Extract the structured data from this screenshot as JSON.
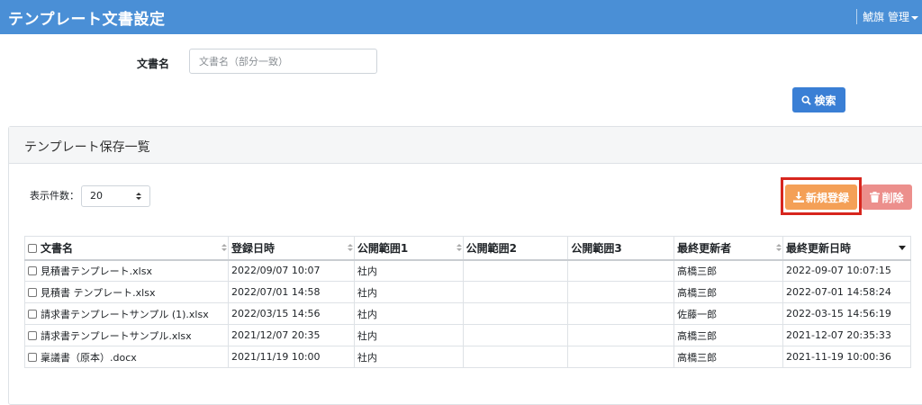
{
  "header": {
    "title": "テンプレート文書設定",
    "user": "鯱旗 管理"
  },
  "search": {
    "label": "文書名",
    "placeholder": "文書名（部分一致）",
    "button": "検索"
  },
  "panel": {
    "title": "テンプレート保存一覧"
  },
  "pagination": {
    "label": "表示件数：",
    "value": "20"
  },
  "actions": {
    "new_label": "新規登録",
    "delete_label": "削除"
  },
  "colors": {
    "header": "#4a8fd6",
    "search_button": "#3a7fd5",
    "new_button": "#f4a057",
    "delete_button": "#ec8f8c",
    "highlight": "#d7261e"
  },
  "table": {
    "columns": [
      "文書名",
      "登録日時",
      "公開範囲1",
      "公開範囲2",
      "公開範囲3",
      "最終更新者",
      "最終更新日時"
    ],
    "rows": [
      {
        "name": "見積書テンプレート.xlsx",
        "registered": "2022/09/07 10:07",
        "scope1": "社内",
        "scope2": "",
        "scope3": "",
        "updater": "高橋三郎",
        "updated": "2022-09-07 10:07:15"
      },
      {
        "name": "見積書 テンプレート.xlsx",
        "registered": "2022/07/01 14:58",
        "scope1": "社内",
        "scope2": "",
        "scope3": "",
        "updater": "高橋三郎",
        "updated": "2022-07-01 14:58:24"
      },
      {
        "name": "請求書テンプレートサンプル (1).xlsx",
        "registered": "2022/03/15 14:56",
        "scope1": "社内",
        "scope2": "",
        "scope3": "",
        "updater": "佐藤一郎",
        "updated": "2022-03-15 14:56:19"
      },
      {
        "name": "請求書テンプレートサンプル.xlsx",
        "registered": "2021/12/07 20:35",
        "scope1": "社内",
        "scope2": "",
        "scope3": "",
        "updater": "高橋三郎",
        "updated": "2021-12-07 20:35:33"
      },
      {
        "name": "稟議書（原本）.docx",
        "registered": "2021/11/19 10:00",
        "scope1": "社内",
        "scope2": "",
        "scope3": "",
        "updater": "高橋三郎",
        "updated": "2021-11-19 10:00:36"
      }
    ]
  }
}
